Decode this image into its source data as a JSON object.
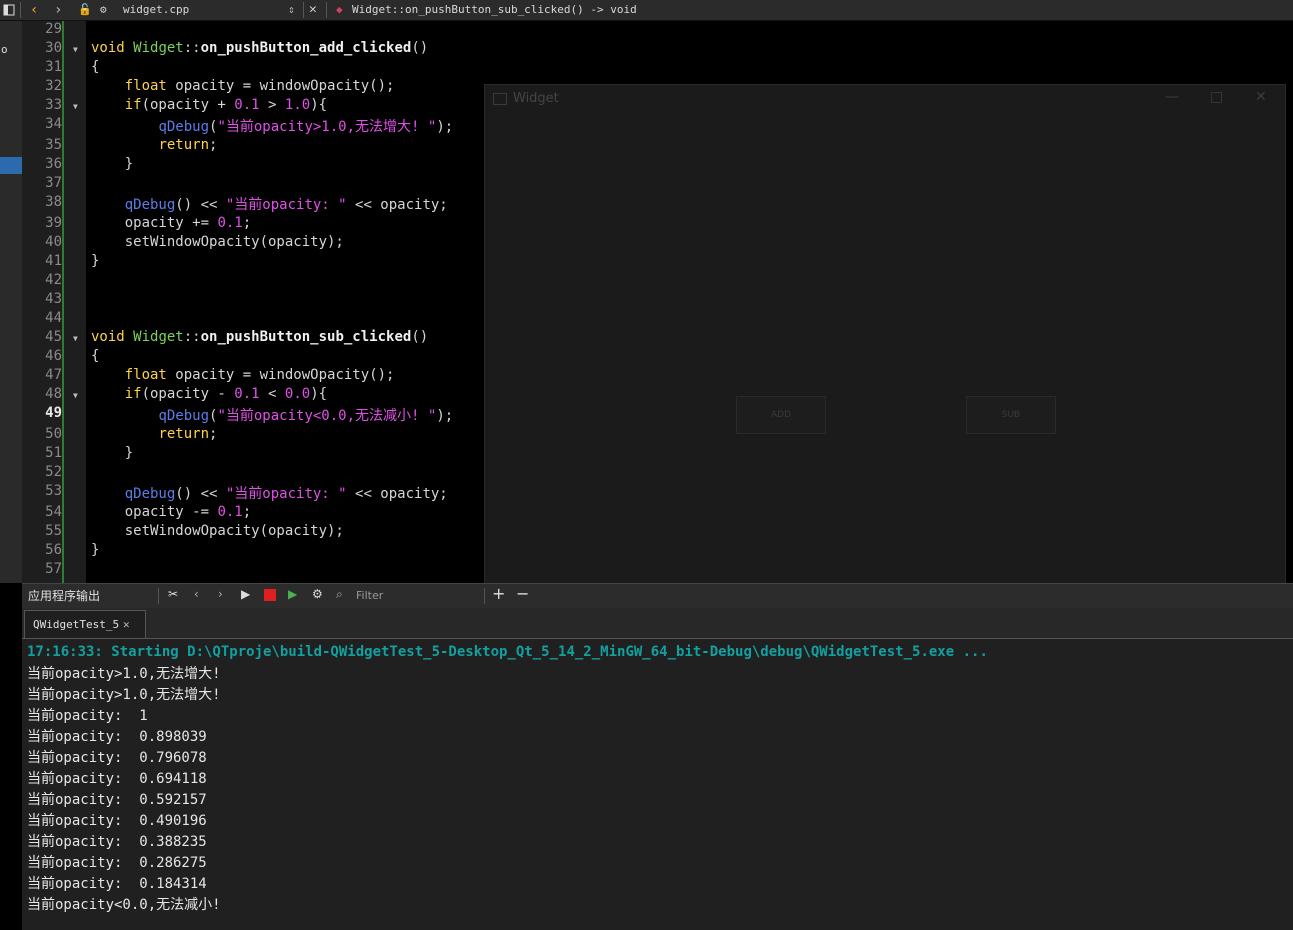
{
  "topbar": {
    "file_name": "widget.cpp",
    "function_sig": "Widget::on_pushButton_sub_clicked() -> void"
  },
  "editor": {
    "lines": [
      {
        "n": "29",
        "html": ""
      },
      {
        "n": "30",
        "html": "<span class='kw'>void</span> <span class='cls'>Widget</span>::<span class='fn'>on_pushButton_add_clicked</span>()",
        "fold": true
      },
      {
        "n": "31",
        "html": "{"
      },
      {
        "n": "32",
        "html": "    <span class='kw'>float</span> opacity = windowOpacity();"
      },
      {
        "n": "33",
        "html": "    <span class='kw'>if</span>(opacity + <span class='num'>0.1</span> &gt; <span class='num'>1.0</span>){",
        "fold": true
      },
      {
        "n": "34",
        "html": "        <span class='qd'>qDebug</span>(<span class='str'>\"当前opacity&gt;1.0,无法增大! \"</span>);"
      },
      {
        "n": "35",
        "html": "        <span class='kw'>return</span>;"
      },
      {
        "n": "36",
        "html": "    }"
      },
      {
        "n": "37",
        "html": ""
      },
      {
        "n": "38",
        "html": "    <span class='qd'>qDebug</span>() &lt;&lt; <span class='str'>\"当前opacity: \"</span> &lt;&lt; opacity;"
      },
      {
        "n": "39",
        "html": "    opacity += <span class='num'>0.1</span>;"
      },
      {
        "n": "40",
        "html": "    setWindowOpacity(opacity);"
      },
      {
        "n": "41",
        "html": "}"
      },
      {
        "n": "42",
        "html": ""
      },
      {
        "n": "43",
        "html": ""
      },
      {
        "n": "44",
        "html": ""
      },
      {
        "n": "45",
        "html": "<span class='kw'>void</span> <span class='cls'>Widget</span>::<span class='fn'>on_pushButton_sub_clicked</span>()",
        "fold": true
      },
      {
        "n": "46",
        "html": "{"
      },
      {
        "n": "47",
        "html": "    <span class='kw'>float</span> opacity = windowOpacity();"
      },
      {
        "n": "48",
        "html": "    <span class='kw'>if</span>(opacity - <span class='num'>0.1</span> &lt; <span class='num'>0.0</span>){",
        "fold": true
      },
      {
        "n": "49",
        "html": "        <span class='qd'>qDebug</span>(<span class='str'>\"当前opacity&lt;0.0,无法减小! \"</span>);",
        "current": true
      },
      {
        "n": "50",
        "html": "        <span class='kw'>return</span>;"
      },
      {
        "n": "51",
        "html": "    }"
      },
      {
        "n": "52",
        "html": ""
      },
      {
        "n": "53",
        "html": "    <span class='qd'>qDebug</span>() &lt;&lt; <span class='str'>\"当前opacity: \"</span> &lt;&lt; opacity;"
      },
      {
        "n": "54",
        "html": "    opacity -= <span class='num'>0.1</span>;"
      },
      {
        "n": "55",
        "html": "    setWindowOpacity(opacity);"
      },
      {
        "n": "56",
        "html": "}"
      },
      {
        "n": "57",
        "html": ""
      }
    ]
  },
  "widget_window": {
    "title": "Widget",
    "add_label": "ADD",
    "sub_label": "SUB"
  },
  "output_pane": {
    "title": "应用程序输出",
    "filter_placeholder": "Filter",
    "tab_label": "QWidgetTest_5",
    "start_line": "17:16:33: Starting D:\\QTproje\\build-QWidgetTest_5-Desktop_Qt_5_14_2_MinGW_64_bit-Debug\\debug\\QWidgetTest_5.exe ...",
    "lines": [
      "当前opacity>1.0,无法增大!",
      "当前opacity>1.0,无法增大!",
      "当前opacity:  1",
      "当前opacity:  0.898039",
      "当前opacity:  0.796078",
      "当前opacity:  0.694118",
      "当前opacity:  0.592157",
      "当前opacity:  0.490196",
      "当前opacity:  0.388235",
      "当前opacity:  0.286275",
      "当前opacity:  0.184314",
      "当前opacity<0.0,无法减小!"
    ]
  },
  "colors": {
    "keyword": "#ffd24a",
    "class_name": "#7ad35a",
    "number_string": "#e050e8",
    "qdebug": "#5a7de8",
    "start_line": "#12a0a0",
    "selection": "#2d6aad"
  }
}
